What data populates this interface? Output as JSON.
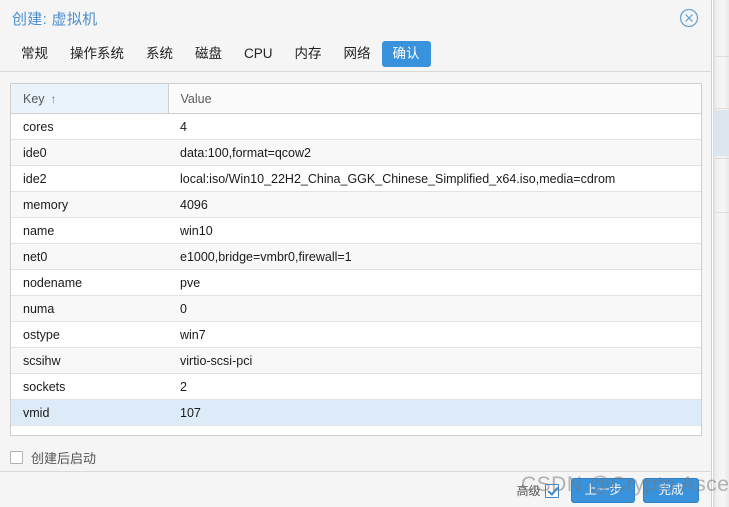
{
  "window": {
    "title": "创建: 虚拟机",
    "close_icon": "close-circle-icon",
    "accent_color": "#3892dc",
    "title_color": "#4d8fcc"
  },
  "tabs": [
    {
      "label": "常规",
      "active": false
    },
    {
      "label": "操作系统",
      "active": false
    },
    {
      "label": "系统",
      "active": false
    },
    {
      "label": "磁盘",
      "active": false
    },
    {
      "label": "CPU",
      "active": false
    },
    {
      "label": "内存",
      "active": false
    },
    {
      "label": "网络",
      "active": false
    },
    {
      "label": "确认",
      "active": true
    }
  ],
  "table": {
    "columns": [
      "Key",
      "Value"
    ],
    "sort_column": "Key",
    "sort_indicator": "↑",
    "rows": [
      {
        "key": "cores",
        "value": "4"
      },
      {
        "key": "ide0",
        "value": "data:100,format=qcow2"
      },
      {
        "key": "ide2",
        "value": "local:iso/Win10_22H2_China_GGK_Chinese_Simplified_x64.iso,media=cdrom"
      },
      {
        "key": "memory",
        "value": "4096"
      },
      {
        "key": "name",
        "value": "win10"
      },
      {
        "key": "net0",
        "value": "e1000,bridge=vmbr0,firewall=1"
      },
      {
        "key": "nodename",
        "value": "pve"
      },
      {
        "key": "numa",
        "value": "0"
      },
      {
        "key": "ostype",
        "value": "win7"
      },
      {
        "key": "scsihw",
        "value": "virtio-scsi-pci"
      },
      {
        "key": "sockets",
        "value": "2"
      },
      {
        "key": "vmid",
        "value": "107"
      }
    ],
    "selected_row_index": 11
  },
  "start_after_create": {
    "label": "创建后启动",
    "checked": false
  },
  "footer": {
    "advanced_label": "高级",
    "advanced_checked": true,
    "back_label": "上一步",
    "finish_label": "完成"
  },
  "watermark": {
    "text": "CSDN @Crypto Ascetic"
  }
}
